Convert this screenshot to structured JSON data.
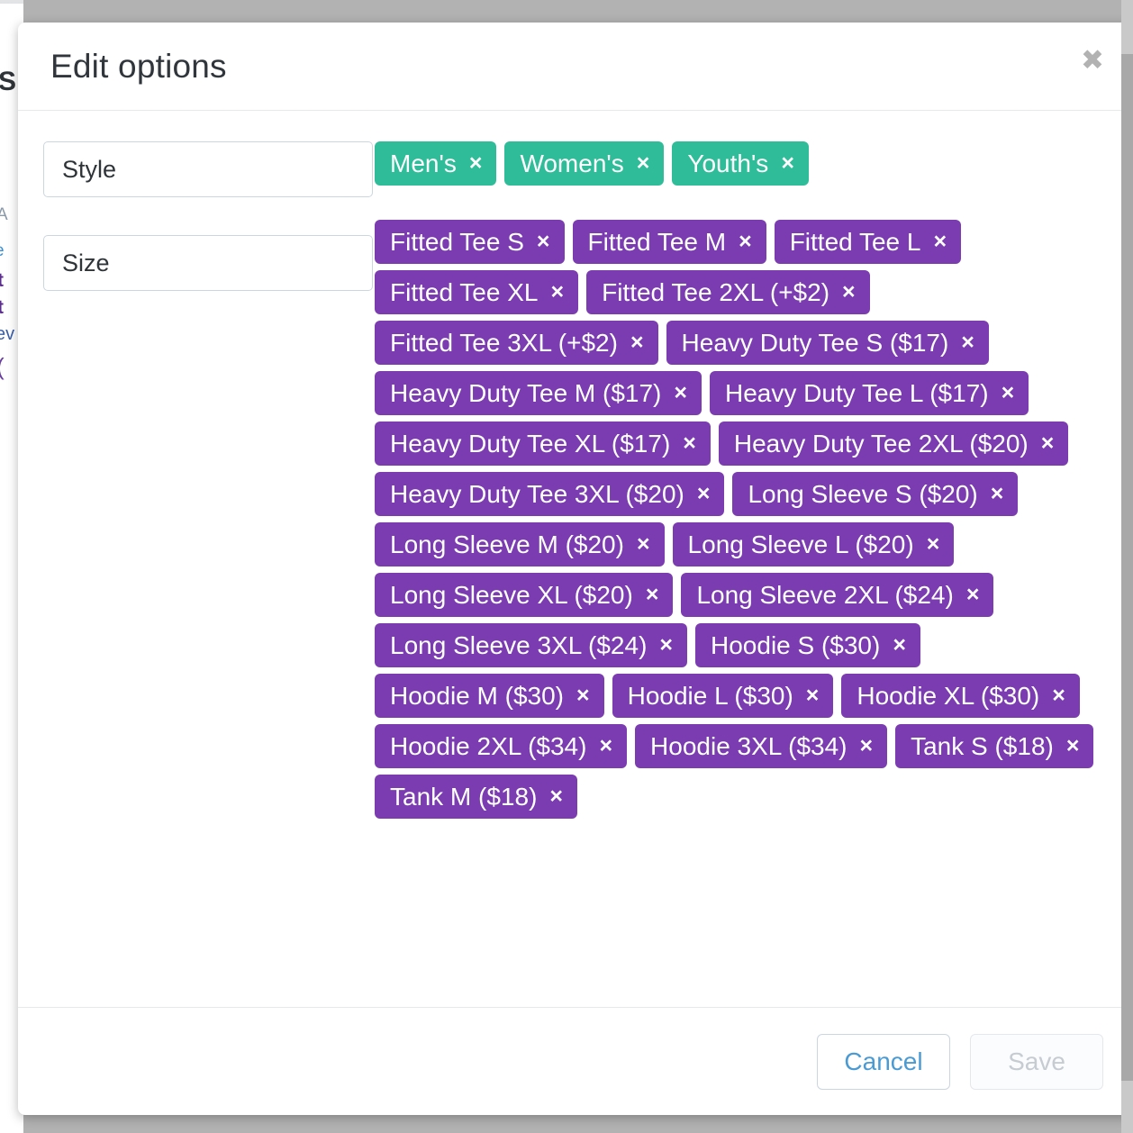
{
  "backdrop": {
    "color": "#b2b2b2",
    "partial_text": {
      "s": "S",
      "a": "A",
      "e": "e",
      "t1": "t",
      "t2": "t",
      "ev": "ev",
      "paren": "("
    }
  },
  "modal": {
    "title": "Edit options",
    "close_icon": "close-icon",
    "close_glyph": "✖"
  },
  "fields": [
    {
      "name": "style",
      "value": "Style",
      "placeholder": "Style"
    },
    {
      "name": "size",
      "value": "Size",
      "placeholder": "Size"
    }
  ],
  "colors": {
    "style_tag": "#2ebd98",
    "size_tag": "#7a3cb0",
    "cancel_text": "#4a9ad4",
    "save_text_disabled": "#c6ccd2",
    "title_text": "#30363c"
  },
  "style_tags": [
    {
      "label": "Men's",
      "remove": "×"
    },
    {
      "label": "Women's",
      "remove": "×"
    },
    {
      "label": "Youth's",
      "remove": "×"
    }
  ],
  "size_tags": [
    {
      "label": "Fitted Tee S",
      "remove": "×"
    },
    {
      "label": "Fitted Tee M",
      "remove": "×"
    },
    {
      "label": "Fitted Tee L",
      "remove": "×"
    },
    {
      "label": "Fitted Tee XL",
      "remove": "×"
    },
    {
      "label": "Fitted Tee 2XL (+$2)",
      "remove": "×"
    },
    {
      "label": "Fitted Tee 3XL (+$2)",
      "remove": "×"
    },
    {
      "label": "Heavy Duty Tee S ($17)",
      "remove": "×"
    },
    {
      "label": "Heavy Duty Tee M ($17)",
      "remove": "×"
    },
    {
      "label": "Heavy Duty Tee L ($17)",
      "remove": "×"
    },
    {
      "label": "Heavy Duty Tee XL ($17)",
      "remove": "×"
    },
    {
      "label": "Heavy Duty Tee 2XL ($20)",
      "remove": "×"
    },
    {
      "label": "Heavy Duty Tee 3XL ($20)",
      "remove": "×"
    },
    {
      "label": "Long Sleeve S ($20)",
      "remove": "×"
    },
    {
      "label": "Long Sleeve M ($20)",
      "remove": "×"
    },
    {
      "label": "Long Sleeve L ($20)",
      "remove": "×"
    },
    {
      "label": "Long Sleeve XL ($20)",
      "remove": "×"
    },
    {
      "label": "Long Sleeve 2XL ($24)",
      "remove": "×"
    },
    {
      "label": "Long Sleeve 3XL ($24)",
      "remove": "×"
    },
    {
      "label": "Hoodie S ($30)",
      "remove": "×"
    },
    {
      "label": "Hoodie M ($30)",
      "remove": "×"
    },
    {
      "label": "Hoodie L ($30)",
      "remove": "×"
    },
    {
      "label": "Hoodie XL ($30)",
      "remove": "×"
    },
    {
      "label": "Hoodie 2XL ($34)",
      "remove": "×"
    },
    {
      "label": "Hoodie 3XL ($34)",
      "remove": "×"
    },
    {
      "label": "Tank S ($18)",
      "remove": "×"
    },
    {
      "label": "Tank M ($18)",
      "remove": "×"
    }
  ],
  "footer": {
    "cancel_label": "Cancel",
    "save_label": "Save"
  }
}
